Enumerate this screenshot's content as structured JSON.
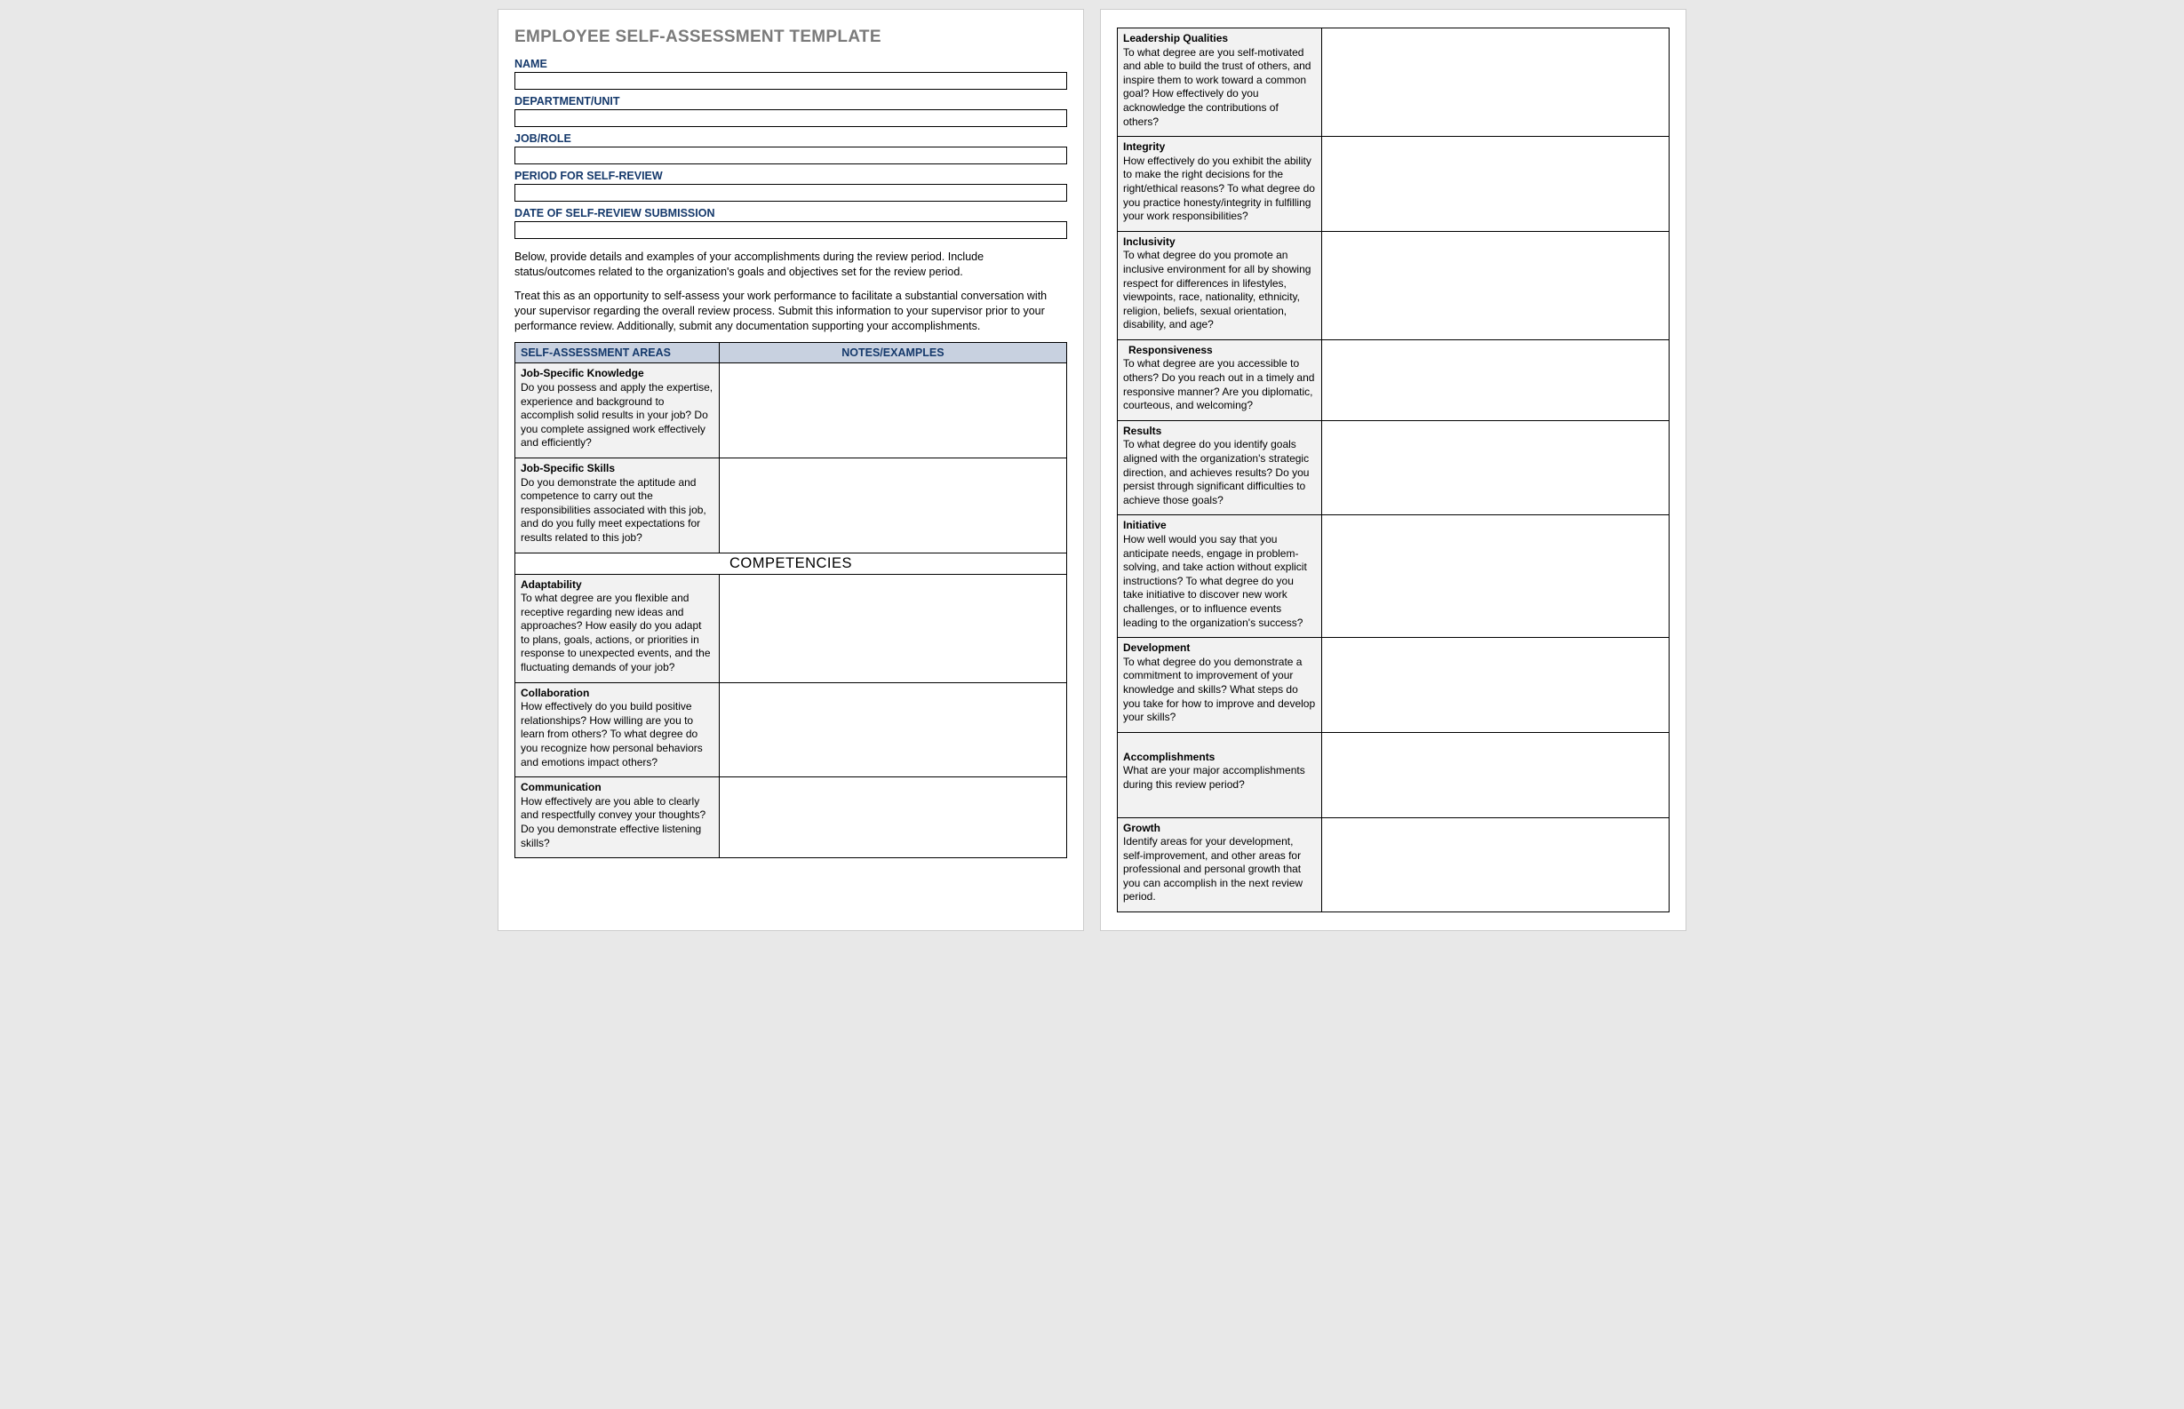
{
  "title": "EMPLOYEE SELF-ASSESSMENT TEMPLATE",
  "fields": {
    "name_label": "NAME",
    "department_label": "DEPARTMENT/UNIT",
    "job_label": "JOB/ROLE",
    "period_label": "PERIOD FOR SELF-REVIEW",
    "date_label": "DATE OF SELF-REVIEW SUBMISSION",
    "name_value": "",
    "department_value": "",
    "job_value": "",
    "period_value": "",
    "date_value": ""
  },
  "instructions": {
    "p1": "Below, provide details and examples of your accomplishments during the review period. Include status/outcomes related to the organization's goals and objectives set for the review period.",
    "p2": "Treat this as an opportunity to self-assess your work performance to facilitate a substantial conversation with your supervisor regarding the overall review process. Submit this information to your supervisor prior to your performance review. Additionally, submit any documentation supporting your accomplishments."
  },
  "table_headers": {
    "areas": "SELF-ASSESSMENT AREAS",
    "notes": "NOTES/EXAMPLES",
    "competencies": "COMPETENCIES"
  },
  "rows_page1_top": [
    {
      "title": "Job-Specific Knowledge",
      "desc": "Do you possess and apply the expertise, experience and background to accomplish solid results in your job? Do you complete assigned work effectively and efficiently?"
    },
    {
      "title": "Job-Specific Skills",
      "desc": "Do you demonstrate the aptitude and competence to carry out the responsibilities associated with this job, and do you fully meet expectations for results related to this job?"
    }
  ],
  "rows_page1_comp": [
    {
      "title": "Adaptability",
      "desc": "To what degree are you flexible and receptive regarding new ideas and approaches? How easily do you adapt to plans, goals, actions, or priorities in response to unexpected events, and the fluctuating demands of your job?"
    },
    {
      "title": "Collaboration",
      "desc": "How effectively do you build positive relationships? How willing are you to learn from others? To what degree do you recognize how personal behaviors and emotions impact others?"
    },
    {
      "title": "Communication",
      "desc": "How effectively are you able to clearly and respectfully convey your thoughts? Do you demonstrate effective listening skills?"
    }
  ],
  "rows_page2": [
    {
      "title": "Leadership Qualities",
      "desc": "To what degree are you self-motivated and able to build the trust of others, and inspire them to work toward a common goal? How effectively do you acknowledge the contributions of others?"
    },
    {
      "title": "Integrity",
      "desc": "How effectively do you exhibit the ability to make the right decisions for the right/ethical reasons? To what degree do you practice honesty/integrity in fulfilling your work responsibilities?"
    },
    {
      "title": "Inclusivity",
      "desc": "To what degree do you promote an inclusive environment for all by showing respect for differences in lifestyles, viewpoints, race, nationality, ethnicity, religion, beliefs, sexual orientation, disability, and age?"
    },
    {
      "title": "Responsiveness",
      "title_indent": true,
      "desc": "To what degree are you accessible to others? Do you reach out in a timely and responsive manner? Are you diplomatic, courteous, and welcoming?"
    },
    {
      "title": "Results",
      "desc": "To what degree do you identify goals aligned with the organization's strategic direction, and achieves results? Do you persist through significant difficulties to achieve those goals?"
    },
    {
      "title": "Initiative",
      "desc": "How well would you say that you anticipate needs, engage in problem-solving, and take action without explicit instructions? To what degree do you take initiative to discover new work challenges, or to influence events leading to the organization's success?"
    },
    {
      "title": "Development",
      "desc": "To what degree do you demonstrate a commitment to improvement of your knowledge and skills? What steps do you take for how to improve and develop your skills?"
    },
    {
      "title": "Accomplishments",
      "desc": "What are your major accomplishments during this review period?",
      "extra_pad": true
    },
    {
      "title": "Growth",
      "desc": "Identify areas for your development, self-improvement, and other areas for professional and personal growth that you can accomplish in the next review period."
    }
  ]
}
